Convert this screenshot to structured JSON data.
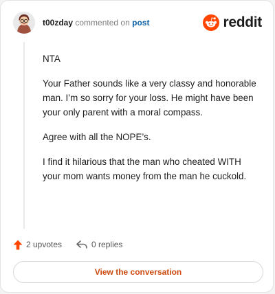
{
  "header": {
    "username": "t00zday",
    "action_text": "commented on",
    "post_link": "post",
    "brand": "reddit"
  },
  "comment": {
    "paragraphs": [
      "NTA",
      "Your Father sounds like a very classy and honorable man. I’m so sorry for your loss. He might have been your only parent with a moral compass.",
      "Agree with all the NOPE’s.",
      "I find it hilarious that the man who cheated WITH your mom wants money from the man he cuckold."
    ]
  },
  "stats": {
    "upvotes": "2 upvotes",
    "replies": "0 replies"
  },
  "cta": {
    "label": "View the conversation"
  },
  "colors": {
    "brand": "#ff4500",
    "link": "#0b5fa5",
    "cta_text": "#cc4a10"
  },
  "icons": [
    "avatar",
    "reddit-logo-icon",
    "upvote-arrow-icon",
    "reply-icon"
  ]
}
